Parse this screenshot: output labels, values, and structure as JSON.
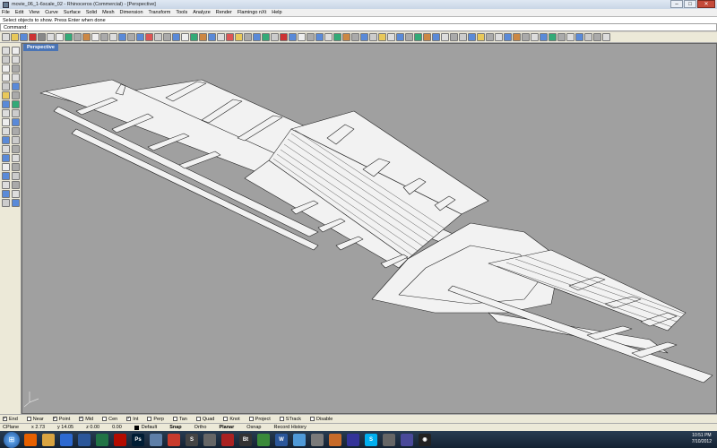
{
  "window": {
    "title": "movie_06_1-6scale_02 - Rhinoceros (Commercial) - [Perspective]",
    "buttons": {
      "minimize": "–",
      "maximize": "□",
      "close": "✕"
    }
  },
  "menu": [
    "File",
    "Edit",
    "View",
    "Curve",
    "Surface",
    "Solid",
    "Mesh",
    "Dimension",
    "Transform",
    "Tools",
    "Analyze",
    "Render",
    "Flamingo nXt",
    "Help"
  ],
  "command_history": "Select objects to show. Press Enter when done",
  "command_prompt": {
    "label": "Command:",
    "value": ""
  },
  "viewport": {
    "tab_label": "Perspective",
    "background": "#a0a0a0",
    "axis_icon": "axis-triad-icon"
  },
  "osnap": [
    {
      "label": "End",
      "checked": true
    },
    {
      "label": "Near",
      "checked": false
    },
    {
      "label": "Point",
      "checked": true
    },
    {
      "label": "Mid",
      "checked": true
    },
    {
      "label": "Cen",
      "checked": false
    },
    {
      "label": "Int",
      "checked": true
    },
    {
      "label": "Perp",
      "checked": false
    },
    {
      "label": "Tan",
      "checked": false
    },
    {
      "label": "Quad",
      "checked": false
    },
    {
      "label": "Knot",
      "checked": false
    },
    {
      "label": "Project",
      "checked": false
    },
    {
      "label": "STrack",
      "checked": false
    },
    {
      "label": "Disable",
      "checked": false
    }
  ],
  "status": {
    "cplane": "CPlane",
    "x": "x 2.73",
    "y": "y 14.05",
    "z": "z 0.00",
    "value": "0.00",
    "layer": "Default",
    "snap": "Snap",
    "ortho": "Ortho",
    "planar": "Planar",
    "osnap": "Osnap",
    "record": "Record History"
  },
  "taskbar": {
    "start": "⊞",
    "icons": [
      {
        "name": "firefox-icon",
        "color": "#e66000",
        "glyph": ""
      },
      {
        "name": "folder-icon",
        "color": "#d9a441",
        "glyph": ""
      },
      {
        "name": "media-player-icon",
        "color": "#2d6ad1",
        "glyph": ""
      },
      {
        "name": "word-icon",
        "color": "#2b579a",
        "glyph": ""
      },
      {
        "name": "excel-icon",
        "color": "#217346",
        "glyph": ""
      },
      {
        "name": "acrobat-icon",
        "color": "#b30b00",
        "glyph": ""
      },
      {
        "name": "photoshop-icon",
        "color": "#001d34",
        "glyph": "Ps"
      },
      {
        "name": "paint-icon",
        "color": "#5e7fa8",
        "glyph": ""
      },
      {
        "name": "sketchup-icon",
        "color": "#c83b2d",
        "glyph": ""
      },
      {
        "name": "s-app-icon",
        "color": "#444",
        "glyph": "S"
      },
      {
        "name": "rhino-icon",
        "color": "#666",
        "glyph": ""
      },
      {
        "name": "red-app-icon",
        "color": "#a22",
        "glyph": ""
      },
      {
        "name": "bt-icon",
        "color": "#333",
        "glyph": "Bt"
      },
      {
        "name": "green-app-icon",
        "color": "#3a8a3a",
        "glyph": ""
      },
      {
        "name": "word-icon-2",
        "color": "#2b579a",
        "glyph": "W"
      },
      {
        "name": "browser-icon",
        "color": "#4f9ad8",
        "glyph": ""
      },
      {
        "name": "app-icon-a",
        "color": "#7a7a7a",
        "glyph": ""
      },
      {
        "name": "app-icon-b",
        "color": "#c76b2a",
        "glyph": ""
      },
      {
        "name": "app-icon-c",
        "color": "#339",
        "glyph": ""
      },
      {
        "name": "skype-icon",
        "color": "#00aff0",
        "glyph": "S"
      },
      {
        "name": "app-icon-d",
        "color": "#666",
        "glyph": ""
      },
      {
        "name": "app-icon-e",
        "color": "#4a4a9a",
        "glyph": ""
      },
      {
        "name": "eye-icon",
        "color": "#222",
        "glyph": "◉"
      }
    ],
    "clock_time": "10:51 PM",
    "clock_date": "7/10/2012"
  }
}
